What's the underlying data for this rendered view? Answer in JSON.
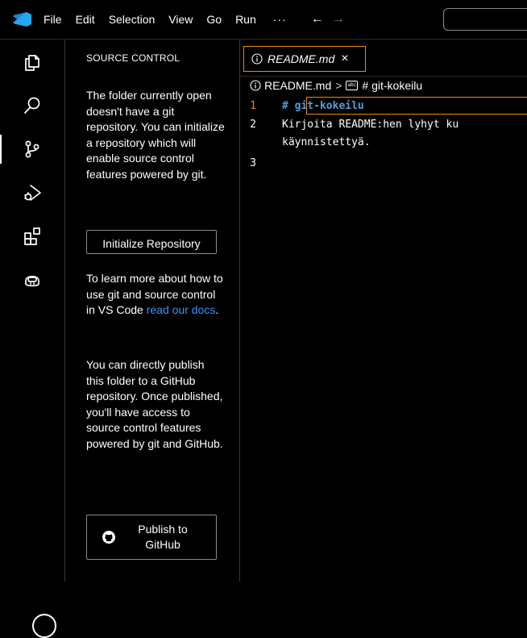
{
  "menu": {
    "items": [
      "File",
      "Edit",
      "Selection",
      "View",
      "Go",
      "Run"
    ],
    "more": "···",
    "back_arrow": "←",
    "forward_arrow": "→"
  },
  "activity_bar": {
    "icons": [
      "explorer-icon",
      "search-icon",
      "source-control-icon",
      "run-debug-icon",
      "extensions-icon",
      "copilot-icon",
      "account-icon"
    ],
    "active": "source-control-icon"
  },
  "sidebar": {
    "title": "SOURCE CONTROL",
    "intro": "The folder currently open doesn't have a git repository. You can initialize a repository which will enable source control features powered by git.",
    "init_button": "Initialize Repository",
    "learn_prefix": "To learn more about how to use git and source control in VS Code ",
    "learn_link": "read our docs",
    "learn_suffix": ".",
    "publish_text": "You can directly publish this folder to a GitHub repository. Once published, you'll have access to source control features powered by git and GitHub.",
    "publish_button": "Publish to GitHub",
    "publish_icon": "github-icon"
  },
  "editor": {
    "tab": {
      "label": "README.md",
      "close": "×",
      "icon": "info-icon"
    },
    "breadcrumb": {
      "file": "README.md",
      "separator": ">",
      "symbol": "# git-kokeilu",
      "symbol_icon": "abc"
    },
    "lines": [
      {
        "number": "1",
        "text": "# git-kokeilu"
      },
      {
        "number": "2",
        "text": "Kirjoita README:hen lyhyt ku"
      },
      {
        "number": "",
        "text": "käynnistettyä."
      },
      {
        "number": "3",
        "text": ""
      }
    ]
  },
  "colors": {
    "background": "#000000",
    "focus_border": "#f38518",
    "link": "#3794ff",
    "heading": "#569cd6",
    "vscode_blue": "#23a9f2"
  }
}
